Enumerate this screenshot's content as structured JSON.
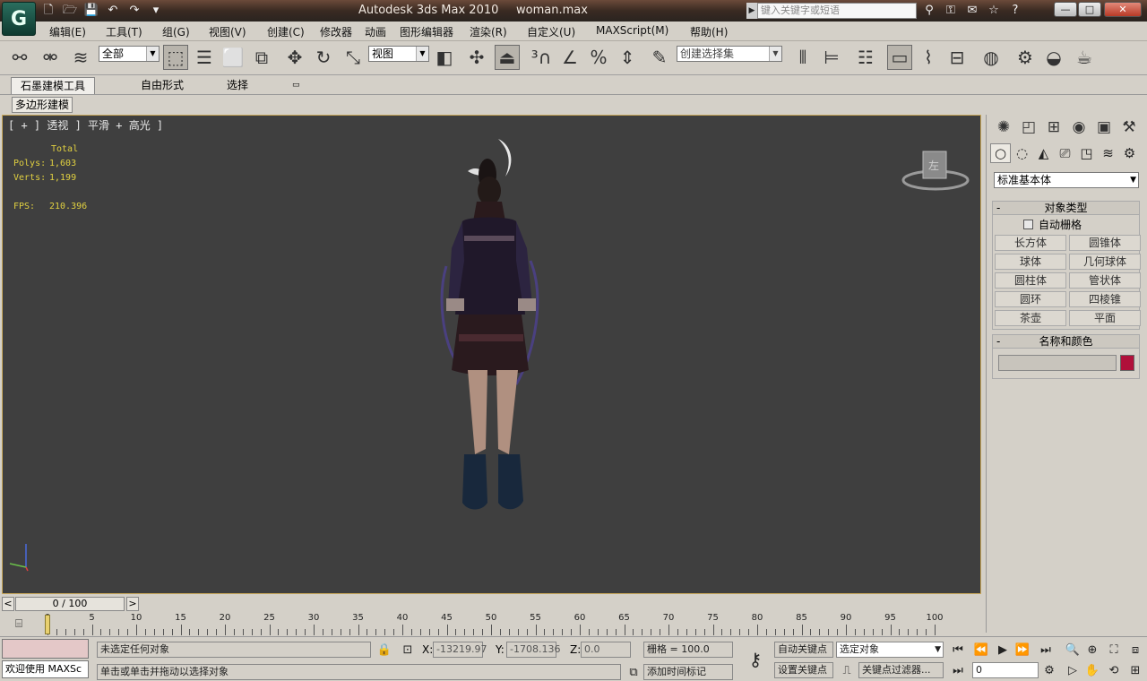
{
  "title_bar": {
    "app_logo": "G",
    "app_title": "Autodesk 3ds Max  2010",
    "doc_name": "woman.max",
    "search_placeholder": "键入关键字或短语",
    "quick_access": [
      "new-icon",
      "open-icon",
      "save-icon",
      "undo-icon",
      "redo-icon",
      "more-icon"
    ],
    "min_label": "—",
    "max_label": "□",
    "close_label": "✕"
  },
  "menu": [
    "编辑(E)",
    "工具(T)",
    "组(G)",
    "视图(V)",
    "创建(C)",
    "修改器",
    "动画",
    "图形编辑器",
    "渲染(R)",
    "自定义(U)",
    "MAXScript(M)",
    "帮助(H)"
  ],
  "toolbar": {
    "selection_filter": "全部",
    "ref_coord": "视图",
    "named_selection": "创建选择集"
  },
  "ribbon": {
    "tabs": [
      "石墨建模工具",
      "自由形式",
      "选择"
    ],
    "subtab": "多边形建模"
  },
  "viewport": {
    "label": "[ + ] 透视 ] 平滑 + 高光 ]",
    "stats": {
      "header": "Total",
      "polys_label": "Polys:",
      "polys": "1,603",
      "verts_label": "Verts:",
      "verts": "1,199",
      "fps_label": "FPS:",
      "fps": "210.396"
    },
    "gizmo_label": "左"
  },
  "command_panel": {
    "category": "标准基本体",
    "object_type_title": "对象类型",
    "autogrid": "自动栅格",
    "objects": [
      "长方体",
      "圆锥体",
      "球体",
      "几何球体",
      "圆柱体",
      "管状体",
      "圆环",
      "四棱锥",
      "茶壶",
      "平面"
    ],
    "name_color_title": "名称和颜色",
    "color": "#b0103a"
  },
  "time": {
    "frame_display": "0 / 100",
    "ticks": [
      "0",
      "5",
      "10",
      "15",
      "20",
      "25",
      "30",
      "35",
      "40",
      "45",
      "50",
      "55",
      "60",
      "65",
      "70",
      "75",
      "80",
      "85",
      "90",
      "95",
      "100"
    ]
  },
  "status": {
    "script_label": "欢迎使用 MAXSc",
    "selection_status": "未选定任何对象",
    "prompt": "单击或单击并拖动以选择对象",
    "x_label": "X:",
    "x": "-13219.97",
    "y_label": "Y:",
    "y": "-1708.136",
    "z_label": "Z:",
    "z": "0.0",
    "grid": "栅格 = 100.0",
    "add_time_tag": "添加时间标记",
    "auto_key": "自动关键点",
    "set_key": "设置关键点",
    "key_mode": "选定对象",
    "key_filters": "关键点过滤器...",
    "current_frame": "0"
  }
}
